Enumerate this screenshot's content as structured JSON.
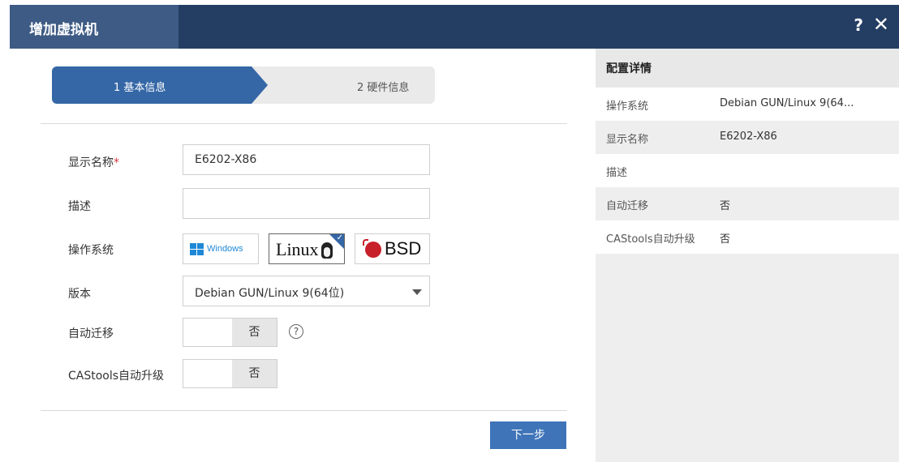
{
  "dialog": {
    "title": "增加虚拟机",
    "help_label": "?",
    "close_label": "✕"
  },
  "steps": [
    {
      "label": "1 基本信息",
      "active": true
    },
    {
      "label": "2 硬件信息",
      "active": false
    }
  ],
  "form": {
    "display_name": {
      "label": "显示名称",
      "required_mark": "*",
      "value": "E6202-X86"
    },
    "description": {
      "label": "描述",
      "value": ""
    },
    "os": {
      "label": "操作系统",
      "options": [
        {
          "name": "Windows",
          "icon": "windows-logo-icon",
          "selected": false
        },
        {
          "name": "Linux",
          "icon": "linux-logo-icon",
          "selected": true
        },
        {
          "name": "BSD",
          "icon": "bsd-logo-icon",
          "selected": false
        }
      ]
    },
    "version": {
      "label": "版本",
      "value": "Debian GUN/Linux 9(64位)"
    },
    "auto_migrate": {
      "label": "自动迁移",
      "value": "否",
      "help": "?"
    },
    "castools_upgrade": {
      "label": "CAStools自动升级",
      "value": "否"
    }
  },
  "buttons": {
    "next": "下一步"
  },
  "details": {
    "title": "配置详情",
    "rows": [
      {
        "key": "操作系统",
        "value": "Debian GUN/Linux 9(64..."
      },
      {
        "key": "显示名称",
        "value": "E6202-X86"
      },
      {
        "key": "描述",
        "value": ""
      },
      {
        "key": "自动迁移",
        "value": "否"
      },
      {
        "key": "CAStools自动升级",
        "value": "否"
      }
    ]
  },
  "colors": {
    "titlebar": "#243d63",
    "accent": "#3567a6",
    "button": "#3f74b8",
    "required": "#d9363e"
  }
}
